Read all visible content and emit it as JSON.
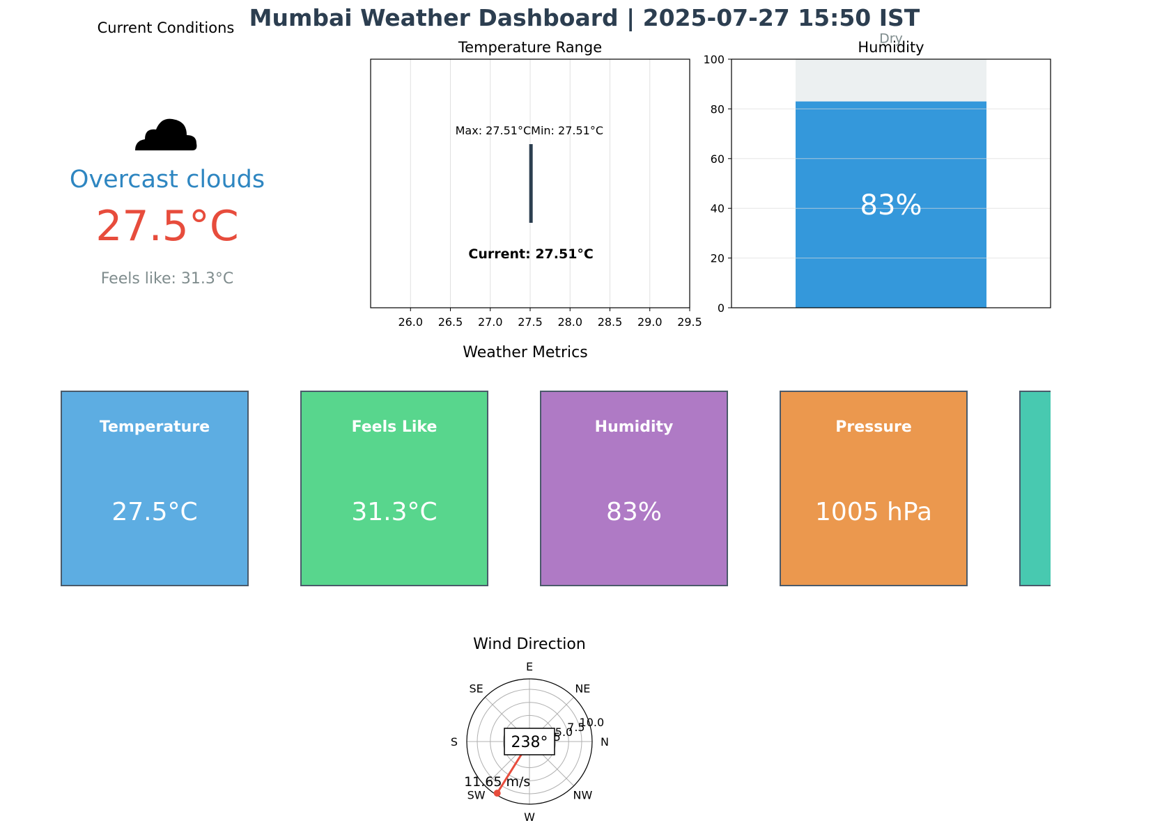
{
  "title": "Mumbai Weather Dashboard | 2025-07-27 15:50 IST",
  "current_conditions": {
    "title": "Current Conditions",
    "icon": "cloud-icon",
    "description": "Overcast clouds",
    "temperature": "27.5°C",
    "feels_like": "Feels like: 31.3°C"
  },
  "metrics": {
    "title": "Weather Metrics",
    "cards": [
      {
        "label": "Temperature",
        "value": "27.5°C",
        "color": "#5dade2"
      },
      {
        "label": "Feels Like",
        "value": "31.3°C",
        "color": "#58d68d"
      },
      {
        "label": "Humidity",
        "value": "83%",
        "color": "#af7ac5"
      },
      {
        "label": "Pressure",
        "value": "1005 hPa",
        "color": "#eb984e"
      },
      {
        "label": "",
        "value": "",
        "color": "#48c9b0"
      }
    ]
  },
  "chart_data": [
    {
      "type": "range",
      "title": "Temperature Range",
      "xlim": [
        25.5,
        29.5
      ],
      "xticks": [
        26.0,
        26.5,
        27.0,
        27.5,
        28.0,
        28.5,
        29.0,
        29.5
      ],
      "xtick_labels": [
        "26.0",
        "26.5",
        "27.0",
        "27.5",
        "28.0",
        "28.5",
        "29.0",
        "29.5"
      ],
      "min": 27.51,
      "max": 27.51,
      "current": 27.51,
      "max_label": "Max: 27.51°C",
      "min_label": "Min: 27.51°C",
      "current_label": "Current: 27.51°C",
      "grid": true,
      "color": "#2c3e50"
    },
    {
      "type": "bar",
      "title": "Humidity",
      "value": 83,
      "value_label": "83%",
      "remainder_label": "Dry",
      "ylim": [
        0,
        100
      ],
      "yticks": [
        0,
        20,
        40,
        60,
        80,
        100
      ],
      "grid": true,
      "bar_color": "#3498db",
      "remainder_color": "#ecf0f1"
    },
    {
      "type": "polar",
      "title": "Wind Direction",
      "direction_deg": 238,
      "direction_label": "238°",
      "speed": 11.65,
      "speed_label": "11.65 m/s",
      "rticks": [
        2.5,
        5.0,
        7.5,
        10.0
      ],
      "rtick_labels": [
        "2.5",
        "5.0",
        "7.5",
        "10.0"
      ],
      "rmax": 12,
      "compass_labels": [
        "N",
        "NE",
        "E",
        "SE",
        "S",
        "SW",
        "W",
        "NW"
      ],
      "compass_angles": [
        0,
        45,
        90,
        135,
        180,
        225,
        270,
        315
      ],
      "color": "#e74c3c"
    }
  ]
}
